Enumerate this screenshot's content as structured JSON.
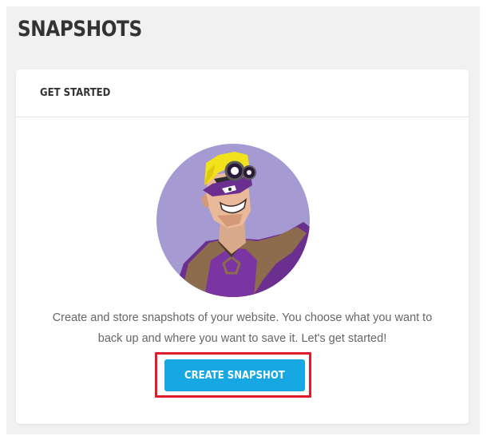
{
  "page": {
    "title": "SNAPSHOTS"
  },
  "card": {
    "header_title": "GET STARTED",
    "description": "Create and store snapshots of your website. You choose what you want to back up and where you want to save it. Let's get started!",
    "create_button_label": "CREATE SNAPSHOT"
  },
  "colors": {
    "accent": "#17a8e3",
    "highlight": "#e01c2b",
    "hero_background": "#a59bd2"
  },
  "icons": {
    "hero": "superhero-illustration"
  }
}
